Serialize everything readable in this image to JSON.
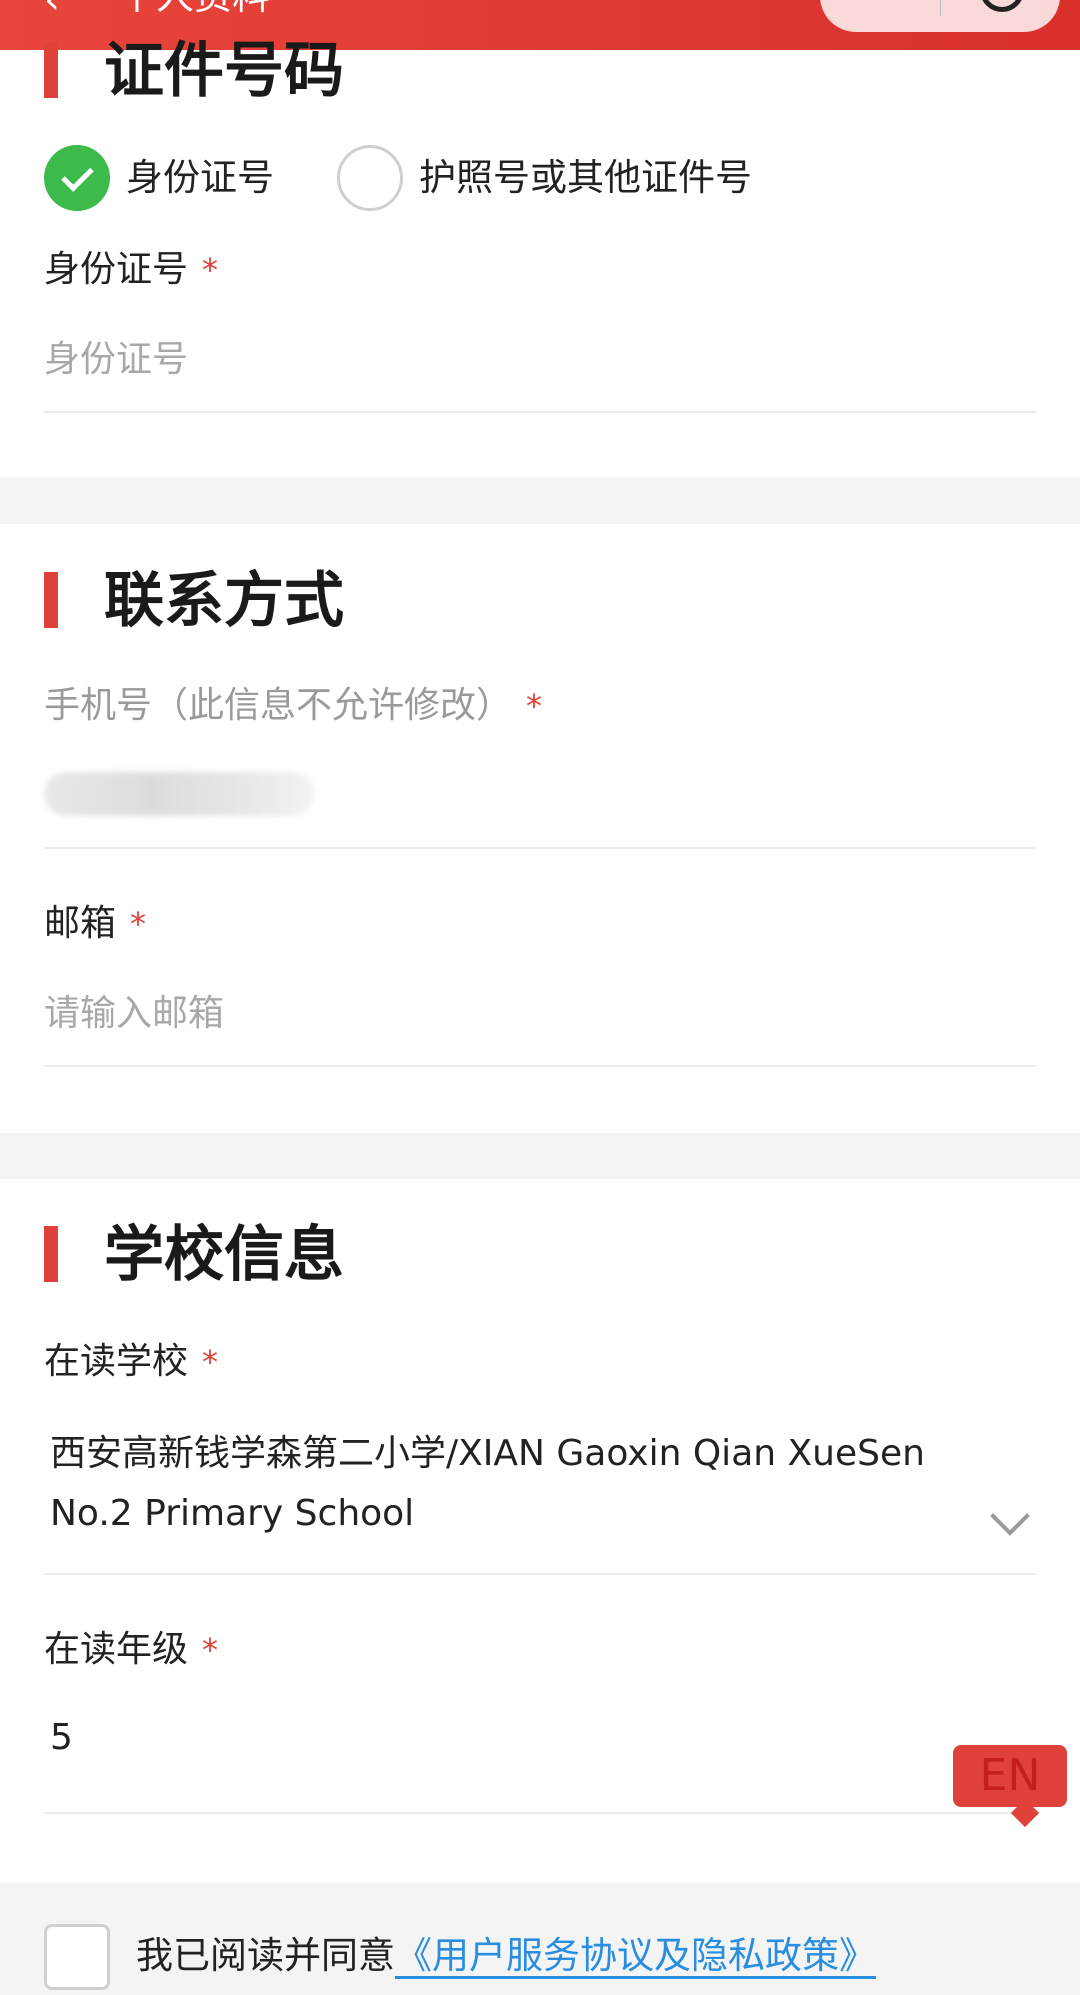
{
  "nav": {
    "back_glyph": "‹",
    "title": "个人资料",
    "capsule_icon": "target-icon"
  },
  "id_section": {
    "title": "证件号码",
    "radio_id_label": "身份证号",
    "radio_passport_label": "护照号或其他证件号",
    "selected": "身份证号",
    "field_label": "身份证号",
    "field_placeholder": "身份证号"
  },
  "contact_section": {
    "title": "联系方式",
    "phone_label": "手机号（此信息不允许修改）",
    "email_label": "邮箱",
    "email_placeholder": "请输入邮箱"
  },
  "school_section": {
    "title": "学校信息",
    "school_label": "在读学校",
    "school_value": "西安高新钱学森第二小学/XIAN Gaoxin Qian XueSen No.2 Primary School",
    "grade_label": "在读年级",
    "grade_value": "5"
  },
  "required_mark": "*",
  "language_toggle": "EN",
  "agreement": {
    "text": "我已阅读并同意",
    "link": "《用户服务协议及隐私政策》"
  },
  "colors": {
    "accent": "#e0413a",
    "success": "#3cbb4a",
    "link": "#2a8ee0"
  }
}
